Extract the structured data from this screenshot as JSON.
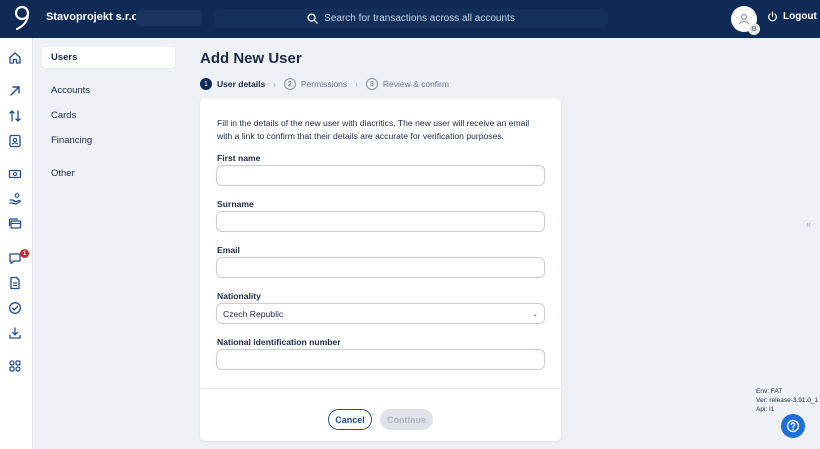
{
  "header": {
    "company": "Stavoprojekt s.r.o.",
    "search_placeholder": "Search for transactions across all accounts",
    "logout_label": "Logout"
  },
  "rail": {
    "icons": [
      "home-icon",
      "arrow-up-right-icon",
      "transfer-arrows-icon",
      "contact-card-icon",
      "banknote-icon",
      "hand-coins-icon",
      "cards-stack-icon",
      "chat-icon",
      "document-icon",
      "check-circle-icon",
      "download-icon",
      "apps-grid-icon"
    ],
    "chat_badge": "1"
  },
  "subnav": {
    "items": [
      {
        "label": "Users"
      },
      {
        "label": "Accounts"
      },
      {
        "label": "Cards"
      },
      {
        "label": "Financing"
      },
      {
        "label": "Other"
      }
    ]
  },
  "page": {
    "title": "Add New User",
    "steps": [
      {
        "num": "1",
        "label": "User details"
      },
      {
        "num": "2",
        "label": "Permissions"
      },
      {
        "num": "3",
        "label": "Review & confirm"
      }
    ]
  },
  "form": {
    "intro": "Fill in the details of the new user with diacritics. The new user will receive an email with a link to confirm that their details are accurate for verification purposes.",
    "first_name_label": "First name",
    "first_name_value": "",
    "surname_label": "Surname",
    "surname_value": "",
    "email_label": "Email",
    "email_value": "",
    "nationality_label": "Nationality",
    "nationality_value": "Czech Republic",
    "national_id_label": "National identification number",
    "national_id_value": "",
    "cancel_label": "Cancel",
    "continue_label": "Continue"
  },
  "footer": {
    "env": "Env: FAT",
    "ver": "Ver: release-3.91.0_1",
    "api": "Api: I1"
  },
  "colors": {
    "navy": "#0f2a55",
    "accent_blue": "#1f4d8f",
    "help_blue": "#1f6fd6",
    "badge_red": "#d6282b",
    "background": "#eef1f5"
  }
}
